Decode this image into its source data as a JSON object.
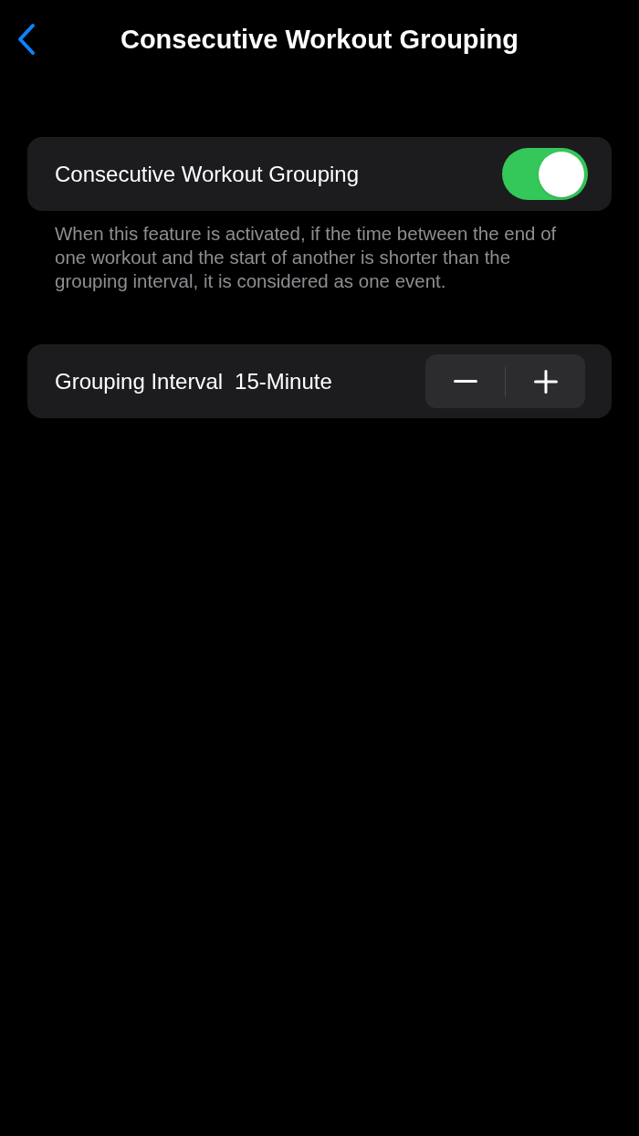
{
  "nav_bar": {
    "title": "Consecutive Workout Grouping"
  },
  "toggle_row": {
    "label": "Consecutive Workout Grouping",
    "on": true
  },
  "footnote": "When this feature is activated, if the time between the end of one workout and the start of another is shorter than the grouping interval, it is considered as one event.",
  "interval_row": {
    "label": "Grouping Interval",
    "value": "15-Minute"
  }
}
